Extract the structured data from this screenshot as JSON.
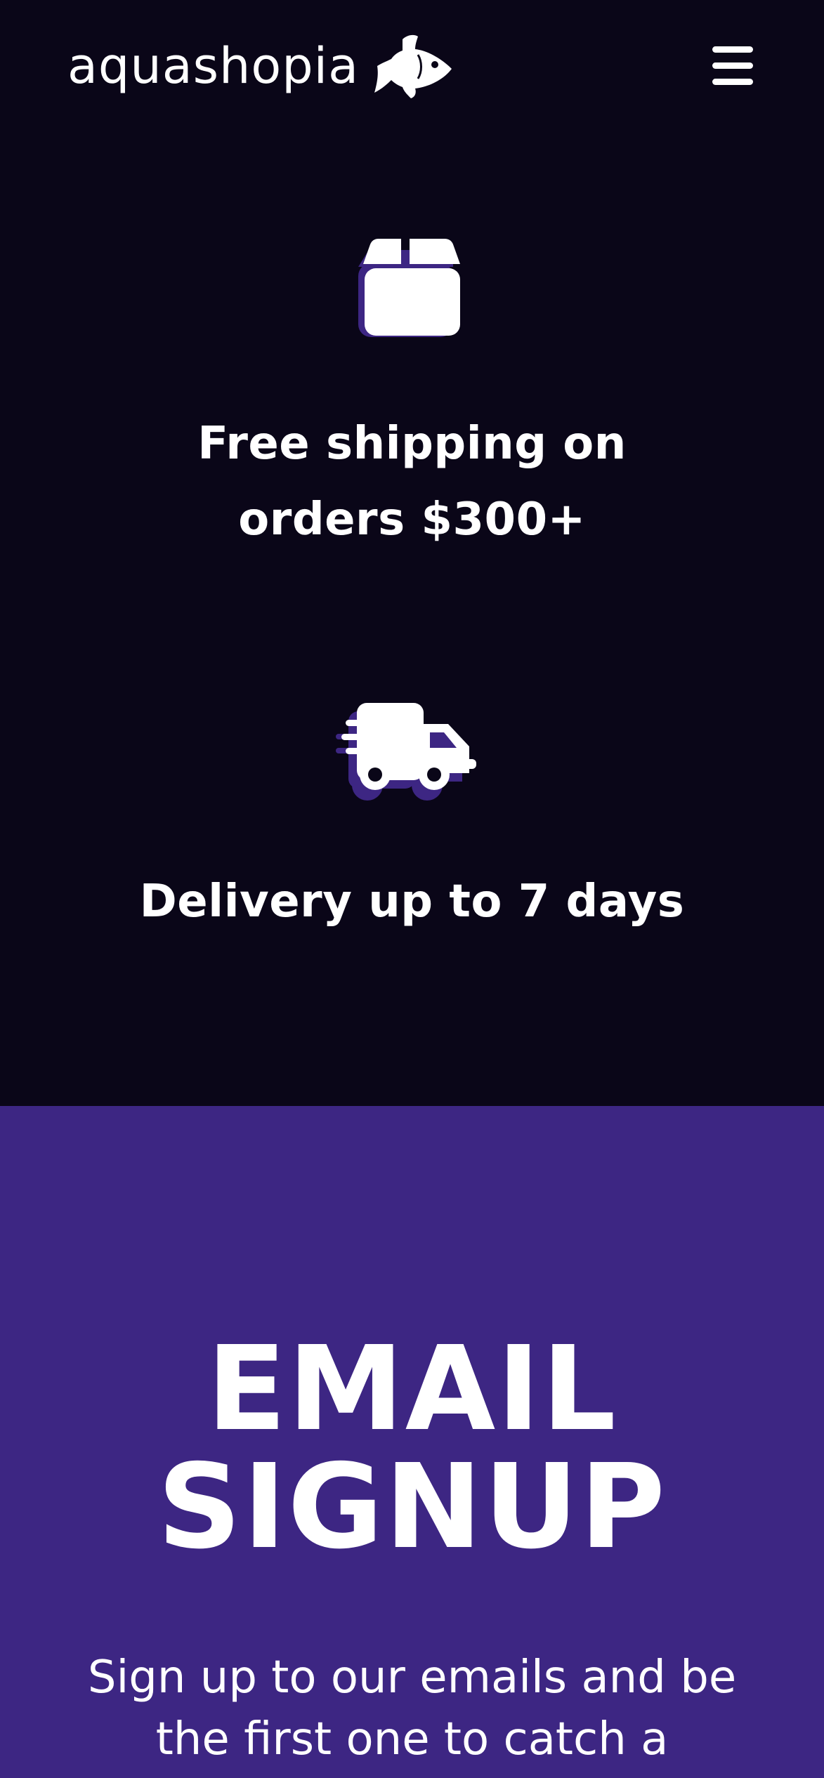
{
  "header": {
    "logo_text": "aquashopia",
    "logo_icon": "fish-icon",
    "menu_icon": "hamburger-menu-icon"
  },
  "features": [
    {
      "icon": "box-icon",
      "text": "Free shipping on orders $300+"
    },
    {
      "icon": "fast-truck-icon",
      "text": "Delivery up to 7 days"
    }
  ],
  "signup": {
    "title": "EMAIL SIGNUP",
    "description": "Sign up to our emails and be the first one to catch a"
  },
  "colors": {
    "background_dark": "#0a0618",
    "accent_purple": "#3d2683",
    "text": "#ffffff"
  }
}
